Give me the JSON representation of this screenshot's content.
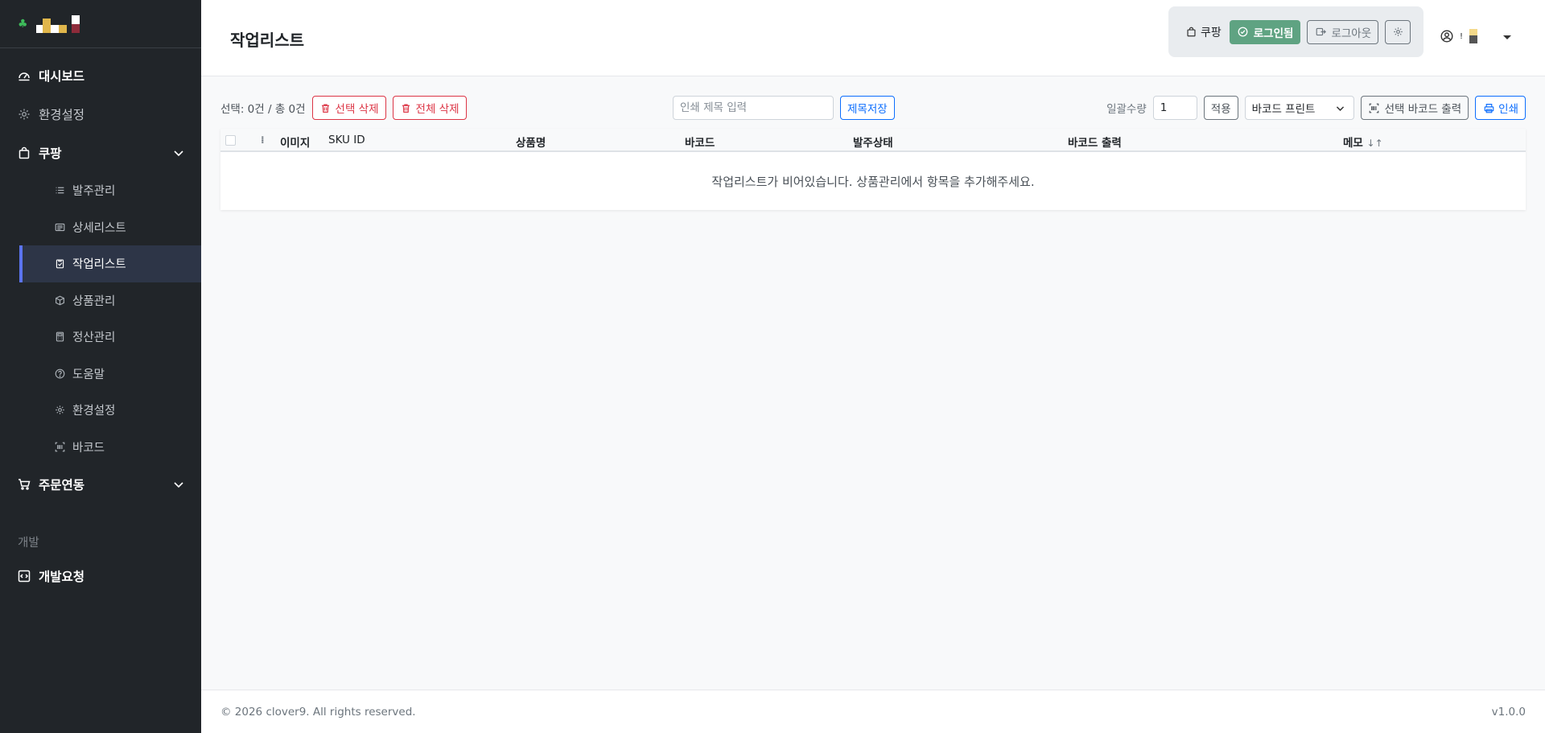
{
  "sidebar": {
    "items": [
      {
        "label": "대시보드",
        "icon": "dashboard-icon"
      },
      {
        "label": "환경설정",
        "icon": "gear-icon"
      },
      {
        "label": "쿠팡",
        "icon": "bag-icon"
      }
    ],
    "coupang_sub": [
      {
        "label": "발주관리",
        "icon": "list-icon"
      },
      {
        "label": "상세리스트",
        "icon": "card-list-icon"
      },
      {
        "label": "작업리스트",
        "icon": "clipboard-check-icon",
        "active": true
      },
      {
        "label": "상품관리",
        "icon": "box-icon"
      },
      {
        "label": "정산관리",
        "icon": "calculator-icon"
      },
      {
        "label": "도움말",
        "icon": "question-circle-icon"
      },
      {
        "label": "환경설정",
        "icon": "gear-icon"
      },
      {
        "label": "바코드",
        "icon": "barcode-icon"
      }
    ],
    "order_link": "주문연동",
    "section_dev": "개발",
    "dev_request": "개발요청"
  },
  "header": {
    "title": "작업리스트",
    "coupang_label": "쿠팡",
    "logged_in_label": "로그인됨",
    "logout_label": "로그아웃",
    "user_marker": "!"
  },
  "toolbar": {
    "selection": "선택: 0건 / 총 0건",
    "delete_selected": "선택 삭제",
    "delete_all": "전체 삭제",
    "title_placeholder": "인쇄 제목 입력",
    "save_title": "제목저장",
    "bulk_qty_label": "일괄수량",
    "bulk_qty_value": "1",
    "apply": "적용",
    "printer_select": "바코드 프린트",
    "print_selected_barcode": "선택 바코드 출력",
    "print": "인쇄"
  },
  "table": {
    "headers": [
      "이미지",
      "SKU ID",
      "상품명",
      "바코드",
      "발주상태",
      "바코드 출력",
      "메모"
    ],
    "empty_message": "작업리스트가 비어있습니다. 상품관리에서 항목을 추가해주세요."
  },
  "footer": {
    "copyright": "© 2026 clover9. All rights reserved.",
    "version": "v1.0.0"
  },
  "colors": {
    "sidebar_bg": "#212529",
    "active_accent": "#5b74f0",
    "green": "#5fa382",
    "danger": "#dc3545",
    "primary": "#0d6efd"
  }
}
